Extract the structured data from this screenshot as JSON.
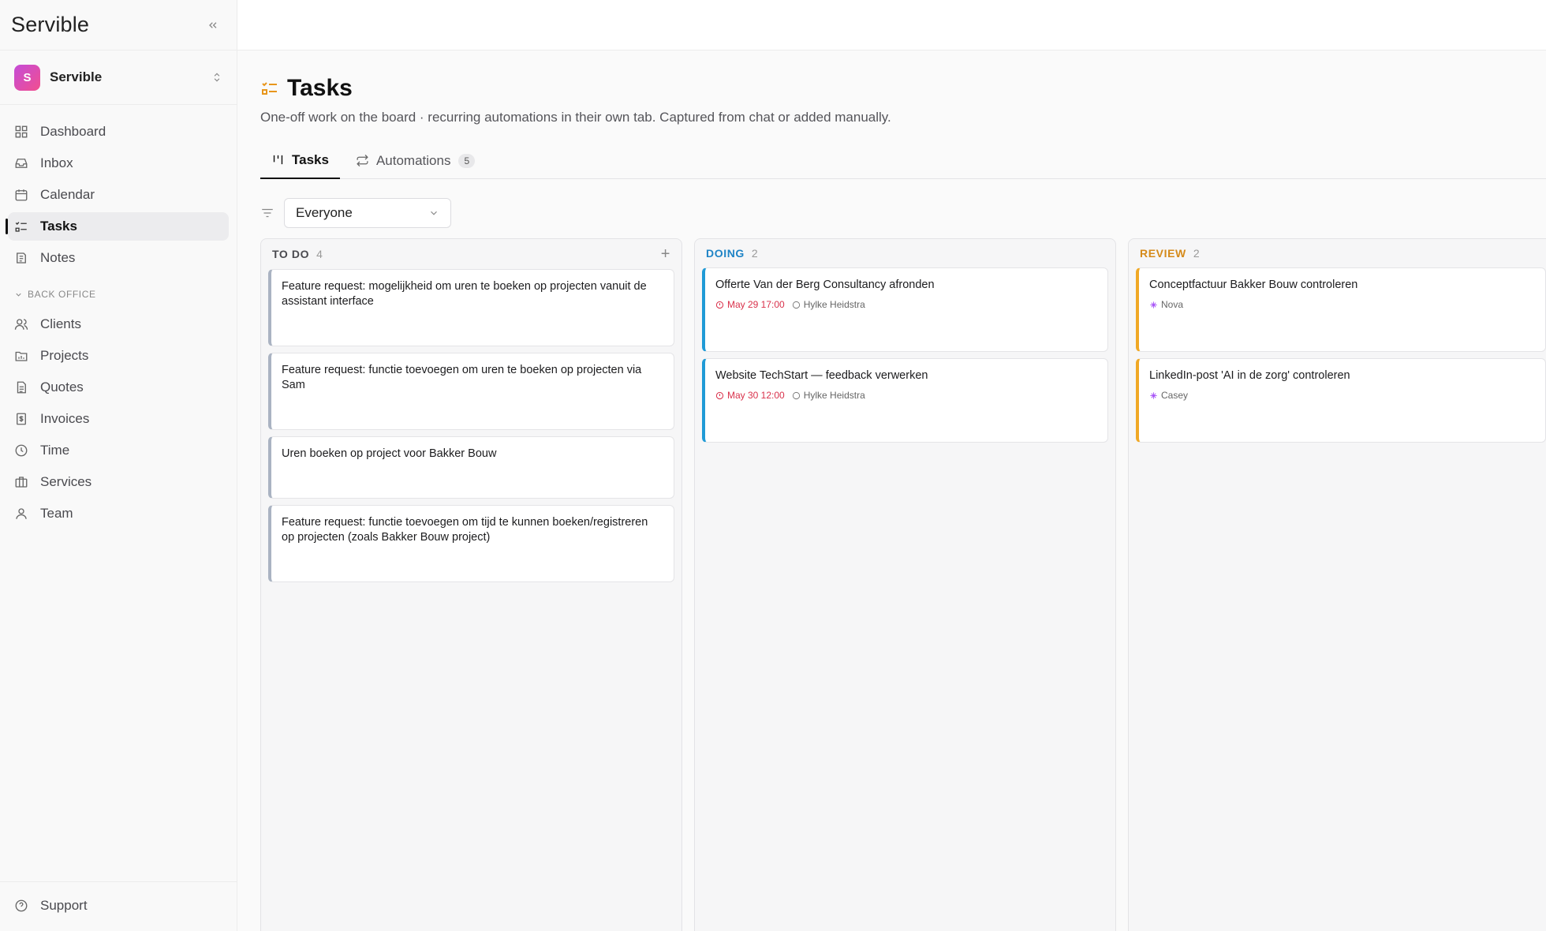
{
  "app": {
    "brand": "Servible",
    "workspace": "Servible",
    "workspace_initial": "S"
  },
  "nav": {
    "main": [
      {
        "label": "Dashboard"
      },
      {
        "label": "Inbox"
      },
      {
        "label": "Calendar"
      },
      {
        "label": "Tasks",
        "active": true
      },
      {
        "label": "Notes"
      }
    ],
    "section_label": "BACK OFFICE",
    "back_office": [
      {
        "label": "Clients"
      },
      {
        "label": "Projects"
      },
      {
        "label": "Quotes"
      },
      {
        "label": "Invoices"
      },
      {
        "label": "Time"
      },
      {
        "label": "Services"
      },
      {
        "label": "Team"
      }
    ],
    "footer": {
      "support": "Support"
    }
  },
  "page": {
    "title": "Tasks",
    "subtitle": "One-off work on the board · recurring automations in their own tab. Captured from chat or added manually.",
    "tabs": [
      {
        "label": "Tasks",
        "active": true
      },
      {
        "label": "Automations",
        "count": "5"
      }
    ],
    "filter": {
      "value": "Everyone"
    }
  },
  "board": {
    "columns": [
      {
        "name": "TO DO",
        "count": "4",
        "color": "#4a4a4f",
        "accent": "#aab3c2",
        "cards": [
          {
            "title": "Feature request: mogelijkheid om uren te boeken op projecten vanuit de assistant interface"
          },
          {
            "title": "Feature request: functie toevoegen om uren te boeken op projecten via Sam"
          },
          {
            "title": "Uren boeken op project voor Bakker Bouw"
          },
          {
            "title": "Feature request: functie toevoegen om tijd te kunnen boeken/registreren op projecten (zoals Bakker Bouw project)"
          }
        ]
      },
      {
        "name": "DOING",
        "count": "2",
        "color": "#1f84c6",
        "accent": "#1f9ad6",
        "cards": [
          {
            "title": "Offerte Van der Berg Consultancy afronden",
            "due": "May 29 17:00",
            "assignee": "Hylke Heidstra"
          },
          {
            "title": "Website TechStart — feedback verwerken",
            "due": "May 30 12:00",
            "assignee": "Hylke Heidstra"
          }
        ]
      },
      {
        "name": "REVIEW",
        "count": "2",
        "color": "#d58a1a",
        "accent": "#f0a825",
        "cards": [
          {
            "title": "Conceptfactuur Bakker Bouw controleren",
            "assignee": "Nova"
          },
          {
            "title": "LinkedIn-post 'AI in de zorg' controleren",
            "assignee": "Casey"
          }
        ]
      }
    ]
  }
}
